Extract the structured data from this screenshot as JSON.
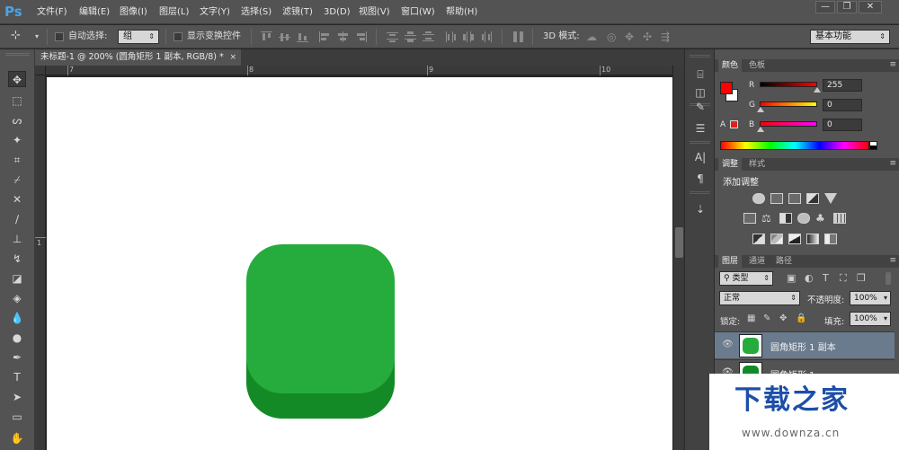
{
  "app": {
    "logo": "Ps",
    "menu": [
      "文件(F)",
      "编辑(E)",
      "图像(I)",
      "图层(L)",
      "文字(Y)",
      "选择(S)",
      "滤镜(T)",
      "3D(D)",
      "视图(V)",
      "窗口(W)",
      "帮助(H)"
    ],
    "window_buttons": {
      "minimize": "—",
      "restore": "❐",
      "close": "✕"
    }
  },
  "options_bar": {
    "auto_select_label": "自动选择:",
    "auto_select_value": "组",
    "transform_controls_label": "显示变换控件",
    "mode_3d_label": "3D 模式:",
    "workspace_value": "基本功能"
  },
  "document": {
    "tab_title": "未标题-1 @ 200% (圆角矩形 1 副本, RGB/8) *",
    "close": "×",
    "ruler_h_labels": [
      "7",
      "8",
      "9",
      "10"
    ],
    "ruler_v_label": "1",
    "shape_top_color": "#25ac3d",
    "shape_bottom_color": "#148a26"
  },
  "color_panel": {
    "tabs": [
      "颜色",
      "色板"
    ],
    "r_label": "R",
    "r_value": "255",
    "g_label": "G",
    "g_value": "0",
    "b_label": "B",
    "b_value": "0",
    "foreground_color": "#ff0000",
    "background_color": "#ffffff",
    "alert_label": "A"
  },
  "adjust_panel": {
    "tabs": [
      "调整",
      "样式"
    ],
    "heading": "添加调整",
    "icons": [
      "brightness-contrast-icon",
      "levels-icon",
      "curves-icon",
      "exposure-icon",
      "vibrance-icon",
      "hue-saturation-icon",
      "color-balance-icon",
      "black-white-icon",
      "photo-filter-icon",
      "channel-mixer-icon",
      "color-lookup-icon",
      "invert-icon",
      "posterize-icon",
      "threshold-icon",
      "gradient-map-icon",
      "selective-color-icon"
    ]
  },
  "layers_panel": {
    "tabs": [
      "图层",
      "通道",
      "路径"
    ],
    "filter_value": "类型",
    "blend_mode": "正常",
    "opacity_label": "不透明度:",
    "opacity_value": "100%",
    "lock_label": "锁定:",
    "fill_label": "填充:",
    "fill_value": "100%",
    "layers": [
      {
        "name": "圆角矩形 1 副本",
        "selected": true,
        "thumb_color": "#25ac3d"
      },
      {
        "name": "圆角矩形 1",
        "selected": false,
        "thumb_color": "#148a26"
      }
    ]
  },
  "watermark": {
    "title": "下载之家",
    "url": "www.downza.cn"
  }
}
